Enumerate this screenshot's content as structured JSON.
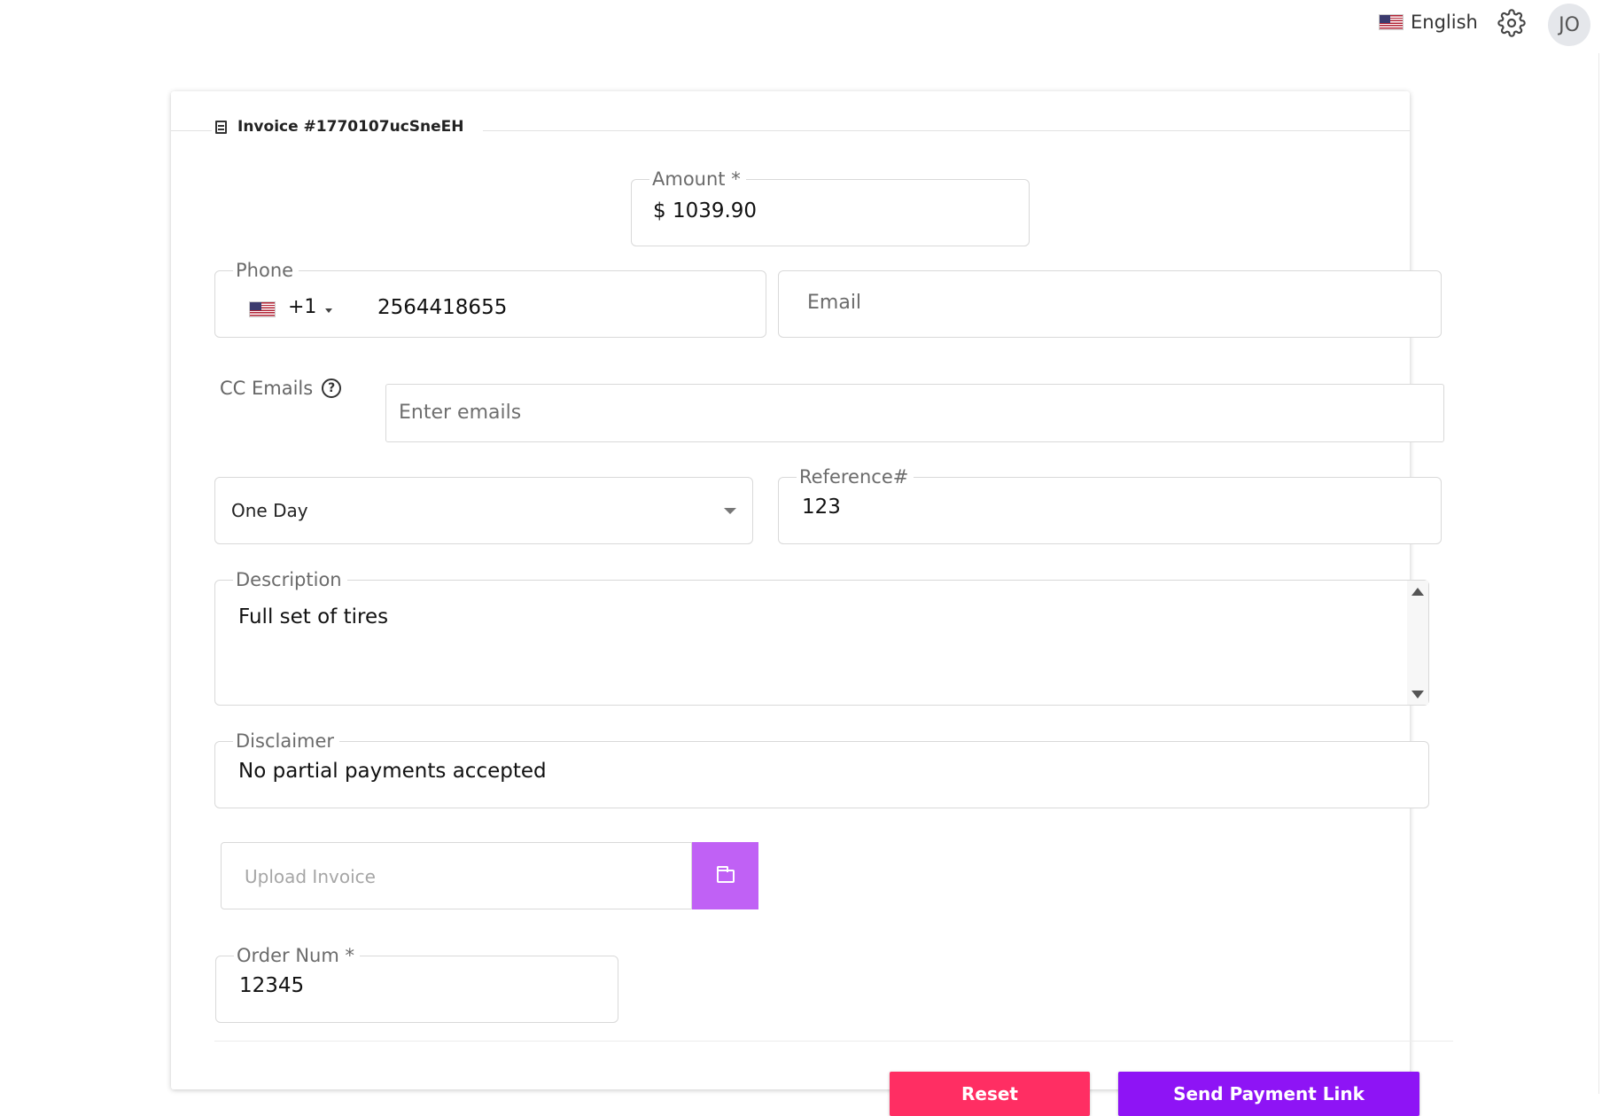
{
  "topbar": {
    "language": "English",
    "avatar_initials": "JO"
  },
  "invoice": {
    "title": "Invoice #1770107ucSneEH"
  },
  "form": {
    "amount": {
      "label": "Amount *",
      "value": "$ 1039.90"
    },
    "phone": {
      "label": "Phone",
      "country_code": "+1",
      "number": "2564418655"
    },
    "email": {
      "placeholder": "Email"
    },
    "cc_emails": {
      "label": "CC Emails",
      "help": "?",
      "placeholder": "Enter emails"
    },
    "expiry": {
      "value": "One Day"
    },
    "reference": {
      "label": "Reference#",
      "value": "123"
    },
    "description": {
      "label": "Description",
      "value": "Full set of tires"
    },
    "disclaimer": {
      "label": "Disclaimer",
      "value": "No partial payments accepted"
    },
    "upload": {
      "placeholder": "Upload Invoice"
    },
    "order_num": {
      "label": "Order Num *",
      "value": "12345"
    }
  },
  "actions": {
    "reset": "Reset",
    "send": "Send Payment Link"
  },
  "colors": {
    "reset": "#ff2e63",
    "send": "#8e14f5",
    "upload": "#c061f5"
  },
  "icons": {
    "flag": "us-flag-icon",
    "settings": "gear-icon",
    "invoice": "document-icon",
    "help": "question-circle-icon",
    "dropdown": "chevron-down-icon",
    "upload": "folder-icon"
  }
}
